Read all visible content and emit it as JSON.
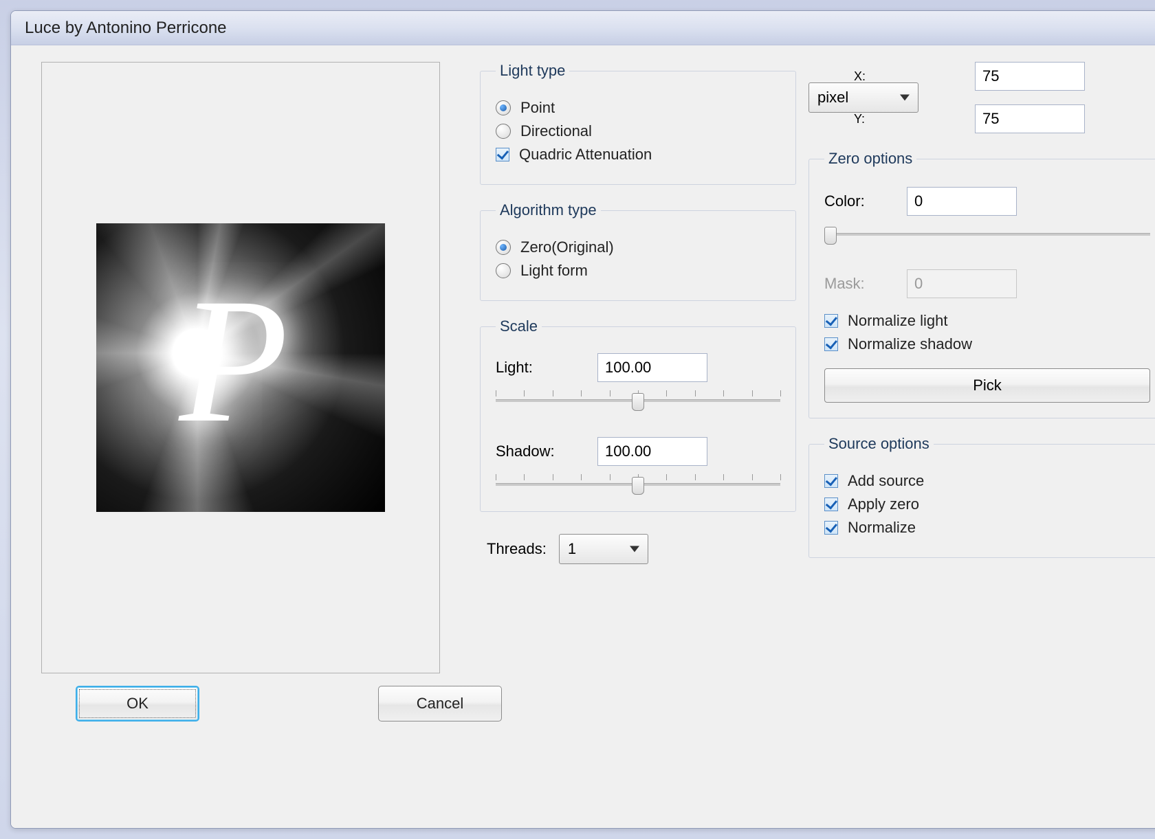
{
  "window": {
    "title": "Luce by Antonino Perricone"
  },
  "buttons": {
    "ok": "OK",
    "cancel": "Cancel",
    "pick": "Pick"
  },
  "lightType": {
    "legend": "Light type",
    "point": "Point",
    "directional": "Directional",
    "quadric": "Quadric Attenuation",
    "selected": "point",
    "quadricChecked": true
  },
  "algorithm": {
    "legend": "Algorithm type",
    "zero": "Zero(Original)",
    "lightform": "Light form",
    "selected": "zero"
  },
  "scale": {
    "legend": "Scale",
    "lightLabel": "Light:",
    "lightValue": "100.00",
    "shadowLabel": "Shadow:",
    "shadowValue": "100.00",
    "sliderPosPct": 50
  },
  "threads": {
    "label": "Threads:",
    "value": "1"
  },
  "position": {
    "xLabel": "X:",
    "xValue": "75",
    "yLabel": "Y:",
    "yValue": "75",
    "unit": "pixel"
  },
  "zero": {
    "legend": "Zero options",
    "colorLabel": "Color:",
    "colorValue": "0",
    "colorSliderPct": 0,
    "maskLabel": "Mask:",
    "maskValue": "0",
    "normLight": "Normalize light",
    "normLightChecked": true,
    "normShadow": "Normalize shadow",
    "normShadowChecked": true
  },
  "source": {
    "legend": "Source options",
    "addSource": "Add source",
    "addSourceChecked": true,
    "applyZero": "Apply zero",
    "applyZeroChecked": true,
    "normalize": "Normalize",
    "normalizeChecked": true
  }
}
